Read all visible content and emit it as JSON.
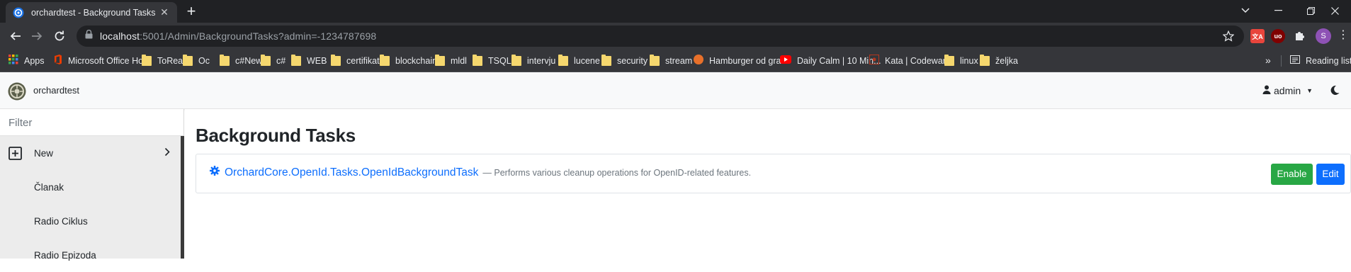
{
  "browser": {
    "tab_title": "orchardtest - Background Tasks",
    "url_host": "localhost",
    "url_rest": ":5001/Admin/BackgroundTasks?admin=-1234787698",
    "profile_initial": "S",
    "extensions": [
      "translate-extension",
      "ublock-extension",
      "puzzle-icon"
    ],
    "bookmarks": [
      {
        "label": "Apps",
        "icon": "apps-icon"
      },
      {
        "label": "Microsoft Office Ho...",
        "icon": "office-icon"
      },
      {
        "label": "ToRead",
        "icon": "folder-icon"
      },
      {
        "label": "Oc",
        "icon": "folder-icon"
      },
      {
        "label": "c#New",
        "icon": "folder-icon"
      },
      {
        "label": "c#",
        "icon": "folder-icon"
      },
      {
        "label": "WEB",
        "icon": "folder-icon"
      },
      {
        "label": "certifikat",
        "icon": "folder-icon"
      },
      {
        "label": "blockchain",
        "icon": "folder-icon"
      },
      {
        "label": "mldl",
        "icon": "folder-icon"
      },
      {
        "label": "TSQL",
        "icon": "folder-icon"
      },
      {
        "label": "intervju",
        "icon": "folder-icon"
      },
      {
        "label": "lucene",
        "icon": "folder-icon"
      },
      {
        "label": "security",
        "icon": "folder-icon"
      },
      {
        "label": "stream",
        "icon": "folder-icon"
      },
      {
        "label": "Hamburger od gra...",
        "icon": "site-icon"
      },
      {
        "label": "Daily Calm | 10 Min...",
        "icon": "youtube-icon"
      },
      {
        "label": "Kata | Codewars",
        "icon": "codewars-icon"
      },
      {
        "label": "linux",
        "icon": "folder-icon"
      },
      {
        "label": "željka",
        "icon": "folder-icon"
      }
    ],
    "reading_list": "Reading list"
  },
  "app": {
    "brand": "orchardtest",
    "user": "admin"
  },
  "sidebar": {
    "filter_placeholder": "Filter",
    "items": [
      {
        "label": "New"
      },
      {
        "label": "Članak"
      },
      {
        "label": "Radio Ciklus"
      },
      {
        "label": "Radio Epizoda"
      }
    ]
  },
  "main": {
    "title": "Background Tasks",
    "tasks": [
      {
        "name": "OrchardCore.OpenId.Tasks.OpenIdBackgroundTask",
        "description": "— Performs various cleanup operations for OpenID-related features.",
        "enable_label": "Enable",
        "edit_label": "Edit"
      }
    ]
  },
  "colors": {
    "link": "#0d6efd",
    "enable_button": "#28a745",
    "edit_button": "#0d6efd",
    "chrome_dark": "#202124"
  }
}
